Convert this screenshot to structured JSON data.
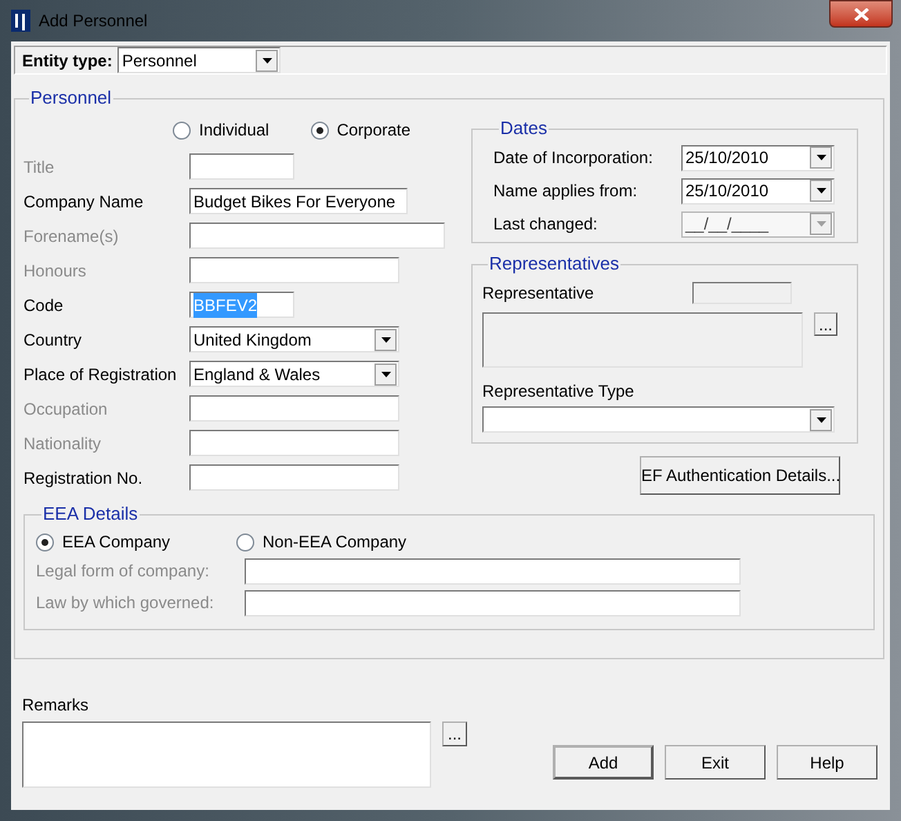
{
  "window": {
    "title": "Add Personnel"
  },
  "entity_type": {
    "label": "Entity type:",
    "value": "Personnel"
  },
  "personnel": {
    "legend": "Personnel",
    "entity_kind": [
      {
        "label": "Individual",
        "selected": false
      },
      {
        "label": "Corporate",
        "selected": true
      }
    ],
    "fields": [
      {
        "label": "Title",
        "kind": "text",
        "disabled": true
      },
      {
        "label": "Company Name",
        "kind": "text",
        "disabled": false,
        "value": "Budget Bikes For Everyone"
      },
      {
        "label": "Forename(s)",
        "kind": "text",
        "disabled": true
      },
      {
        "label": "Honours",
        "kind": "text",
        "disabled": true
      },
      {
        "label": "Code",
        "kind": "text",
        "disabled": false,
        "value": "BBFEV2",
        "text_selected": true
      },
      {
        "label": "Country",
        "kind": "select",
        "disabled": false,
        "value": "United Kingdom"
      },
      {
        "label": "Place of Registration",
        "kind": "select",
        "disabled": false,
        "value": "England & Wales"
      },
      {
        "label": "Occupation",
        "kind": "text",
        "disabled": true
      },
      {
        "label": "Nationality",
        "kind": "text",
        "disabled": true
      },
      {
        "label": "Registration No.",
        "kind": "text",
        "disabled": false
      }
    ],
    "dates": {
      "legend": "Dates",
      "fields": [
        {
          "label": "Date of Incorporation:",
          "value": "25/10/2010",
          "disabled": false
        },
        {
          "label": "Name applies from:",
          "value": "25/10/2010",
          "disabled": false
        },
        {
          "label": "Last changed:",
          "value": "__/__/____",
          "disabled": true
        }
      ]
    },
    "representatives": {
      "legend": "Representatives",
      "representative_label": "Representative",
      "browse_button": "...",
      "type_label": "Representative Type"
    },
    "ef_button": "EF Authentication Details...",
    "eea": {
      "legend": "EEA Details",
      "company_kind": [
        {
          "label": "EEA Company",
          "selected": true
        },
        {
          "label": "Non-EEA Company",
          "selected": false
        }
      ],
      "fields": [
        {
          "label": "Legal form of company:",
          "disabled": true
        },
        {
          "label": "Law by which governed:",
          "disabled": true
        }
      ]
    }
  },
  "remarks": {
    "label": "Remarks",
    "browse_button": "..."
  },
  "buttons": [
    "Add",
    "Exit",
    "Help"
  ]
}
